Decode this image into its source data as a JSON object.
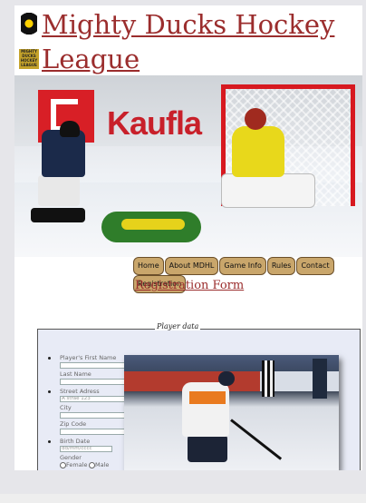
{
  "site": {
    "title": "Mighty Ducks Hockey League",
    "logo_icon": "mighty-ducks-logo-icon",
    "logo_badge_text": "MIGHTY DUCKS HOCKEY LEAGUE"
  },
  "hero": {
    "sign_text": "Kaufla"
  },
  "nav": {
    "items": [
      {
        "label": "Home"
      },
      {
        "label": "About MDHL"
      },
      {
        "label": "Game Info"
      },
      {
        "label": "Rules"
      },
      {
        "label": "Contact"
      },
      {
        "label": "Registration"
      }
    ]
  },
  "page": {
    "heading": "Registration Form"
  },
  "form": {
    "legend": "Player data",
    "first_name_label": "Player's First Name",
    "last_name_label": "Last Name",
    "street_label": "Street Adress",
    "street_placeholder": "A strae 123",
    "city_label": "City",
    "zip_label": "Zip Code",
    "birth_label": "Birth Date",
    "birth_placeholder": "dd/mm/cccc",
    "gender_label": "Gender",
    "gender_options": [
      "Female",
      "Male"
    ]
  }
}
